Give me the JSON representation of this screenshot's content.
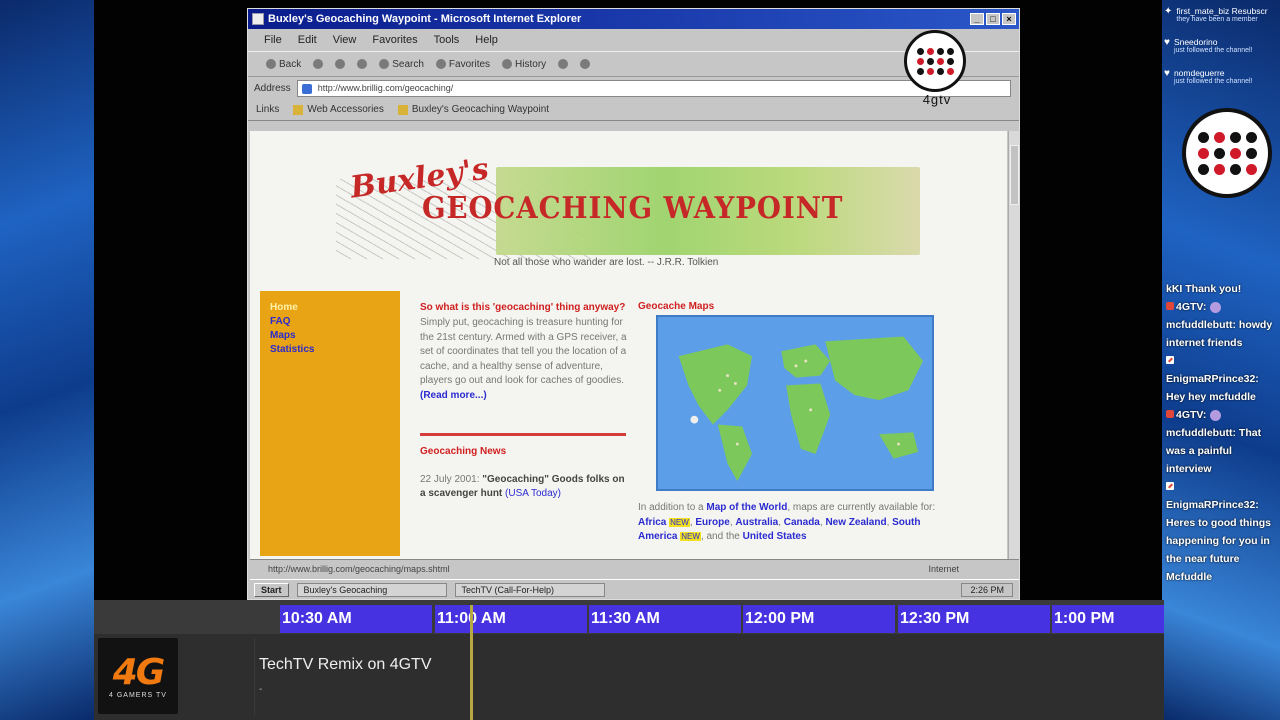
{
  "ie": {
    "title": "Buxley's Geocaching Waypoint - Microsoft Internet Explorer",
    "menu": [
      "File",
      "Edit",
      "View",
      "Favorites",
      "Tools",
      "Help"
    ],
    "toolbar": [
      "Back",
      "Search",
      "Favorites",
      "History"
    ],
    "address_label": "Address",
    "address": "http://www.brillig.com/geocaching/",
    "links_label": "Links",
    "links": [
      "Web Accessories",
      "Buxley's Geocaching Waypoint"
    ],
    "status_url": "http://www.brillig.com/geocaching/maps.shtml",
    "status_zone": "Internet",
    "taskbar_start": "Start",
    "taskbar_tasks": [
      "Buxley's Geocaching",
      "TechTV (Call-For-Help)"
    ],
    "clock": "2:26 PM"
  },
  "page": {
    "banner_script": "Buxley's",
    "banner_title": "GEOCACHING WAYPOINT",
    "quote": "Not all those who wander are lost. -- J.R.R. Tolkien",
    "nav": [
      "Home",
      "FAQ",
      "Maps",
      "Statistics"
    ],
    "what_heading": "So what is this 'geocaching' thing anyway?",
    "what_text": "Simply put, geocaching is treasure hunting for the 21st century. Armed with a GPS receiver, a set of coordinates that tell you the location of a cache, and a healthy sense of adventure, players go out and look for caches of goodies.",
    "read_more": "(Read more...)",
    "news_heading": "Geocaching News",
    "news_date": "22 July 2001:",
    "news_headline": "\"Geocaching\" Goods",
    "news_text": "folks on a scavenger hunt",
    "news_link": "(USA Today)",
    "maps_heading": "Geocache Maps",
    "maps_intro_pre": "In addition to a",
    "maps_link": "Map of the World",
    "maps_intro_post": ", maps are currently available for:",
    "regions": [
      "Africa",
      "Europe",
      "Australia",
      "Canada",
      "New Zealand",
      "South America"
    ],
    "new_badge": "NEW",
    "regions_tail": ", and the",
    "regions_last": "United States"
  },
  "watermark": {
    "label": "4gtv"
  },
  "alerts": [
    {
      "name": "first_mate_biz Resubscr",
      "sub": "they have been a member"
    },
    {
      "name": "Sneedorino",
      "sub": "just followed the channel!"
    },
    {
      "name": "nomdeguerre",
      "sub": "just followed the channel!"
    }
  ],
  "chat": {
    "m0": "kKI Thank you!",
    "m1_user": "4GTV:",
    "m1_text": "mcfuddlebutt: howdy internet friends",
    "m2_user": "EnigmaRPrince32:",
    "m2_text": "Hey hey mcfuddle",
    "m3_user": "4GTV:",
    "m3_text": "mcfuddlebutt: That was a painful interview",
    "m4_user": "EnigmaRPrince32:",
    "m4_text": "Heres to good things happening for you in the near future Mcfuddle"
  },
  "schedule": {
    "times": [
      "10:30 AM",
      "11:00 AM",
      "11:30 AM",
      "12:00 PM",
      "12:30 PM",
      "1:00 PM"
    ],
    "logo_big": "4G",
    "logo_small": "4 GAMERS TV",
    "program_title": "TechTV Remix on 4GTV",
    "program_sub": "-"
  },
  "colors": {
    "slot": "#4632e0",
    "logo": "#f07a10",
    "now_line": "#b8a842"
  }
}
